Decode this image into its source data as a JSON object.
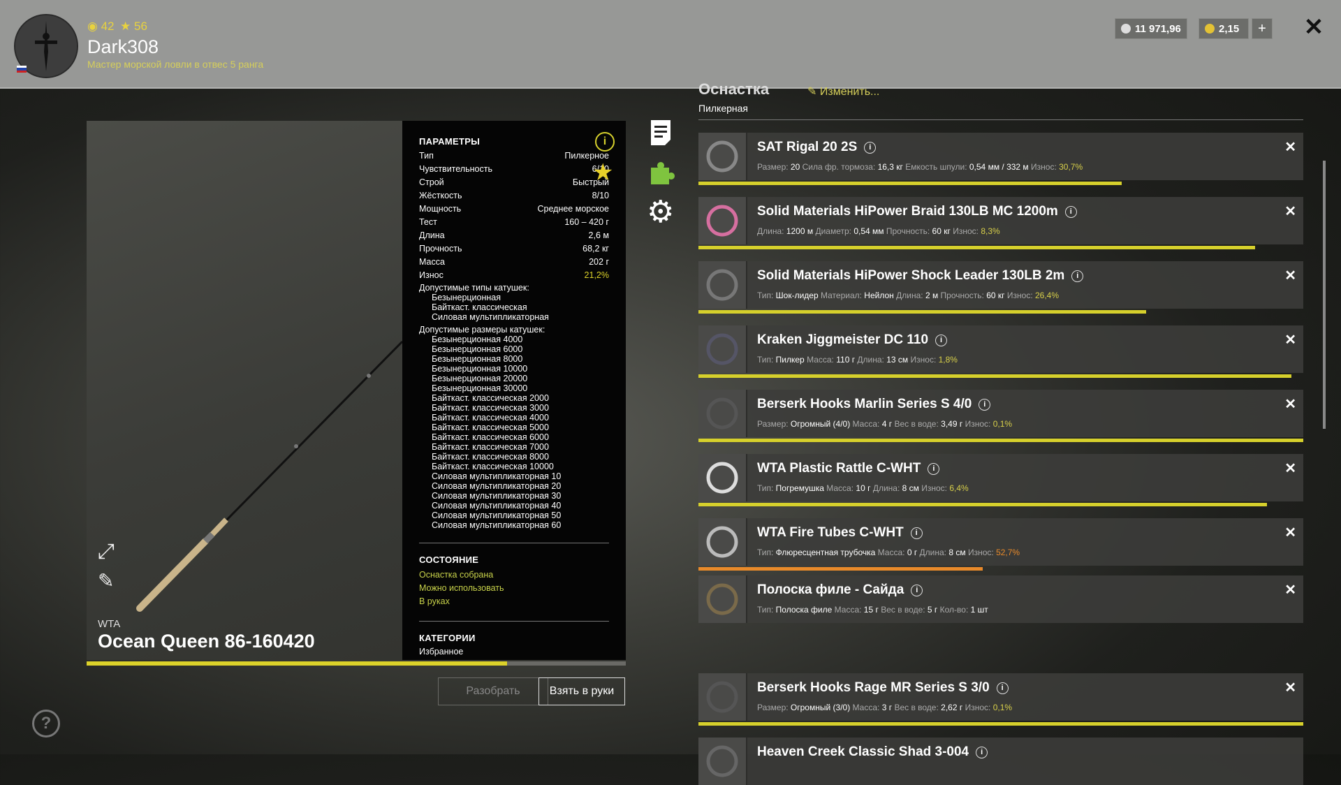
{
  "header": {
    "username": "Dark308",
    "rank": "Мастер морской ловли в отвес 5 ранга",
    "level": "42",
    "stars": "56",
    "silver": "11 971,96",
    "gold": "2,15",
    "add_label": "+",
    "close_label": "✕"
  },
  "rod": {
    "brand": "WTA",
    "name": "Ocean Queen 86-160420",
    "condition_percent": 78,
    "params_title": "ПАРАМЕТРЫ",
    "params": [
      {
        "label": "Тип",
        "value": "Пилкерное"
      },
      {
        "label": "Чувствительность",
        "value": "6/10"
      },
      {
        "label": "Строй",
        "value": "Быстрый"
      },
      {
        "label": "Жёсткость",
        "value": "8/10"
      },
      {
        "label": "Мощность",
        "value": "Среднее морское"
      },
      {
        "label": "Тест",
        "value": "160 – 420 г"
      },
      {
        "label": "Длина",
        "value": "2,6 м"
      },
      {
        "label": "Прочность",
        "value": "68,2 кг"
      },
      {
        "label": "Масса",
        "value": "202 г"
      },
      {
        "label": "Износ",
        "value": "21,2%"
      }
    ],
    "reel_types_title": "Допустимые типы катушек:",
    "reel_types": [
      "Безынерционная",
      "Байткаст. классическая",
      "Силовая мультипликаторная"
    ],
    "reel_sizes_title": "Допустимые размеры катушек:",
    "reel_sizes": [
      "Безынерционная 4000",
      "Безынерционная 6000",
      "Безынерционная 8000",
      "Безынерционная 10000",
      "Безынерционная 20000",
      "Безынерционная 30000",
      "Байткаст. классическая 2000",
      "Байткаст. классическая 3000",
      "Байткаст. классическая 4000",
      "Байткаст. классическая 5000",
      "Байткаст. классическая 6000",
      "Байткаст. классическая 7000",
      "Байткаст. классическая 8000",
      "Байткаст. классическая 10000",
      "Силовая мультипликаторная 10",
      "Силовая мультипликаторная 20",
      "Силовая мультипликаторная 30",
      "Силовая мультипликаторная 40",
      "Силовая мультипликаторная 50",
      "Силовая мультипликаторная 60"
    ],
    "state_title": "СОСТОЯНИЕ",
    "states": [
      "Оснастка собрана",
      "Можно использовать",
      "В руках"
    ],
    "categories_title": "КАТЕГОРИИ",
    "category": "Избранное",
    "btn_disassemble": "Разобрать",
    "btn_take": "Взять в руки"
  },
  "tackle": {
    "title": "Оснастка",
    "subtitle": "Пилкерная",
    "edit_label": "Изменить...",
    "items": [
      {
        "name": "SAT Rigal 20 2S",
        "wear_percent": 70,
        "stats": [
          [
            "Размер:",
            "20"
          ],
          [
            "Сила фр. тормоза:",
            "16,3 кг"
          ],
          [
            "Емкость шпули:",
            "0,54 мм / 332 м"
          ]
        ],
        "wear_label": "Износ:",
        "wear": "30,7%"
      },
      {
        "name": "Solid Materials HiPower Braid 130LB MC 1200m",
        "wear_percent": 92,
        "stats": [
          [
            "Длина:",
            "1200 м"
          ],
          [
            "Диаметр:",
            "0,54 мм"
          ],
          [
            "Прочность:",
            "60 кг"
          ]
        ],
        "wear_label": "Износ:",
        "wear": "8,3%"
      },
      {
        "name": "Solid Materials HiPower Shock Leader 130LB 2m",
        "wear_percent": 74,
        "stats": [
          [
            "Тип:",
            "Шок-лидер"
          ],
          [
            "Материал:",
            "Нейлон"
          ],
          [
            "Длина:",
            "2 м"
          ],
          [
            "Прочность:",
            "60 кг"
          ]
        ],
        "wear_label": "Износ:",
        "wear": "26,4%"
      },
      {
        "name": "Kraken Jiggmeister DC 110",
        "wear_percent": 98,
        "stats": [
          [
            "Тип:",
            "Пилкер"
          ],
          [
            "Масса:",
            "110 г"
          ],
          [
            "Длина:",
            "13 см"
          ]
        ],
        "wear_label": "Износ:",
        "wear": "1,8%"
      },
      {
        "name": "Berserk Hooks Marlin Series S 4/0",
        "wear_percent": 100,
        "stats": [
          [
            "Размер:",
            "Огромный (4/0)"
          ],
          [
            "Масса:",
            "4 г"
          ],
          [
            "Вес в воде:",
            "3,49 г"
          ]
        ],
        "wear_label": "Износ:",
        "wear": "0,1%"
      },
      {
        "name": "WTA Plastic Rattle C-WHT",
        "wear_percent": 94,
        "stats": [
          [
            "Тип:",
            "Погремушка"
          ],
          [
            "Масса:",
            "10 г"
          ],
          [
            "Длина:",
            "8 см"
          ]
        ],
        "wear_label": "Износ:",
        "wear": "6,4%"
      },
      {
        "name": "WTA Fire Tubes C-WHT",
        "wear_percent": 47,
        "stats": [
          [
            "Тип:",
            "Флюресцентная трубочка"
          ],
          [
            "Масса:",
            "0 г"
          ],
          [
            "Длина:",
            "8 см"
          ]
        ],
        "wear_label": "Износ:",
        "wear": "52,7%"
      },
      {
        "name": "Полоска филе - Сайда",
        "wear_percent": null,
        "stats": [
          [
            "Тип:",
            "Полоска филе"
          ],
          [
            "Масса:",
            "15 г"
          ],
          [
            "Вес в воде:",
            "5 г"
          ],
          [
            "Кол-во:",
            "1 шт"
          ]
        ],
        "wear_label": "",
        "wear": ""
      },
      {
        "name": "Berserk Hooks Rage MR Series S 3/0",
        "wear_percent": 100,
        "stats": [
          [
            "Размер:",
            "Огромный (3/0)"
          ],
          [
            "Масса:",
            "3 г"
          ],
          [
            "Вес в воде:",
            "2,62 г"
          ]
        ],
        "wear_label": "Износ:",
        "wear": "0,1%"
      },
      {
        "name": "Heaven Creek Classic Shad 3-004",
        "wear_percent": null,
        "stats": [],
        "wear_label": "",
        "wear": ""
      }
    ]
  },
  "colors": {
    "accent_yellow": "#dcd22a",
    "wear_orange": "#e98a2a",
    "link_green": "#c8d24a"
  },
  "icons": {
    "help": "?",
    "info": "i"
  }
}
